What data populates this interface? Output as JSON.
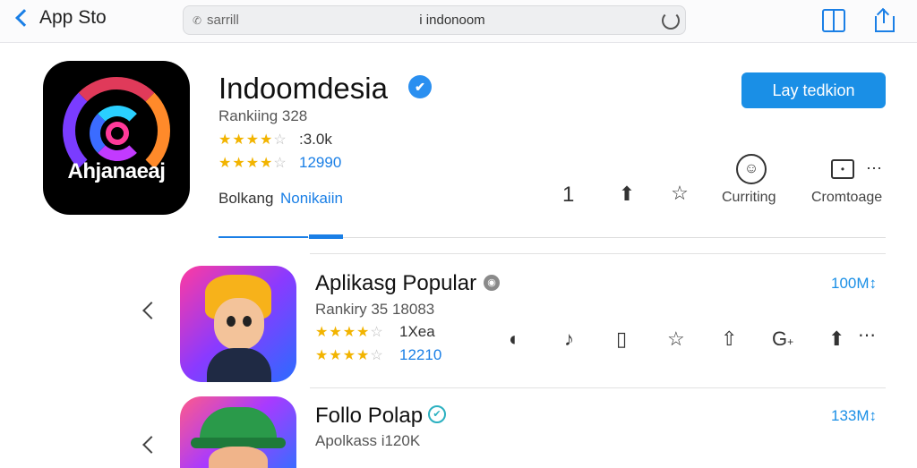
{
  "topbar": {
    "back_label": "App Sto",
    "search_placeholder": "sarrill",
    "url_text": "i indonoom",
    "icons": [
      "chevron-left-icon",
      "search-icon",
      "reload-icon",
      "book-icon",
      "share-icon"
    ]
  },
  "featured": {
    "title": "Indoomdesia",
    "verified_icon": "verified-badge-icon",
    "ranking": "Rankiing 328",
    "rating_1": {
      "stars": 4,
      "text": ":3.0k"
    },
    "rating_2": {
      "stars": 4,
      "text": "12990"
    },
    "icon_text": "Ahjanaeaj",
    "get_button": "Lay tedkion",
    "category_prefix": "Bolkang",
    "category_link": "Nonikaiin",
    "count": "1",
    "actions": [
      {
        "icon": "share-icon",
        "label": ""
      },
      {
        "icon": "star-icon",
        "label": ""
      },
      {
        "icon": "smiley-icon",
        "label": "Curriting"
      },
      {
        "icon": "chat-icon",
        "label": "Cromtoage"
      }
    ]
  },
  "apps": [
    {
      "title": "Aplikasg Popular",
      "badge_icon": "shield-icon",
      "ranking": "Rankiry 35 18083",
      "rating_1": {
        "stars": 4,
        "text": "1Xea"
      },
      "rating_2": {
        "stars": 4,
        "text": "12210"
      },
      "size": "100M↕",
      "actions": [
        "record-icon",
        "music-icon",
        "bookmark-icon",
        "star-icon",
        "upload-icon",
        "g-plus-icon",
        "share-icon",
        "more-icon"
      ]
    },
    {
      "title": "Follo Polap",
      "badge_icon": "verified-badge-icon",
      "ranking": "Apolkass i120K",
      "size": "133M↕"
    }
  ],
  "colors": {
    "accent": "#1a8fe6",
    "star": "#f2b400"
  }
}
